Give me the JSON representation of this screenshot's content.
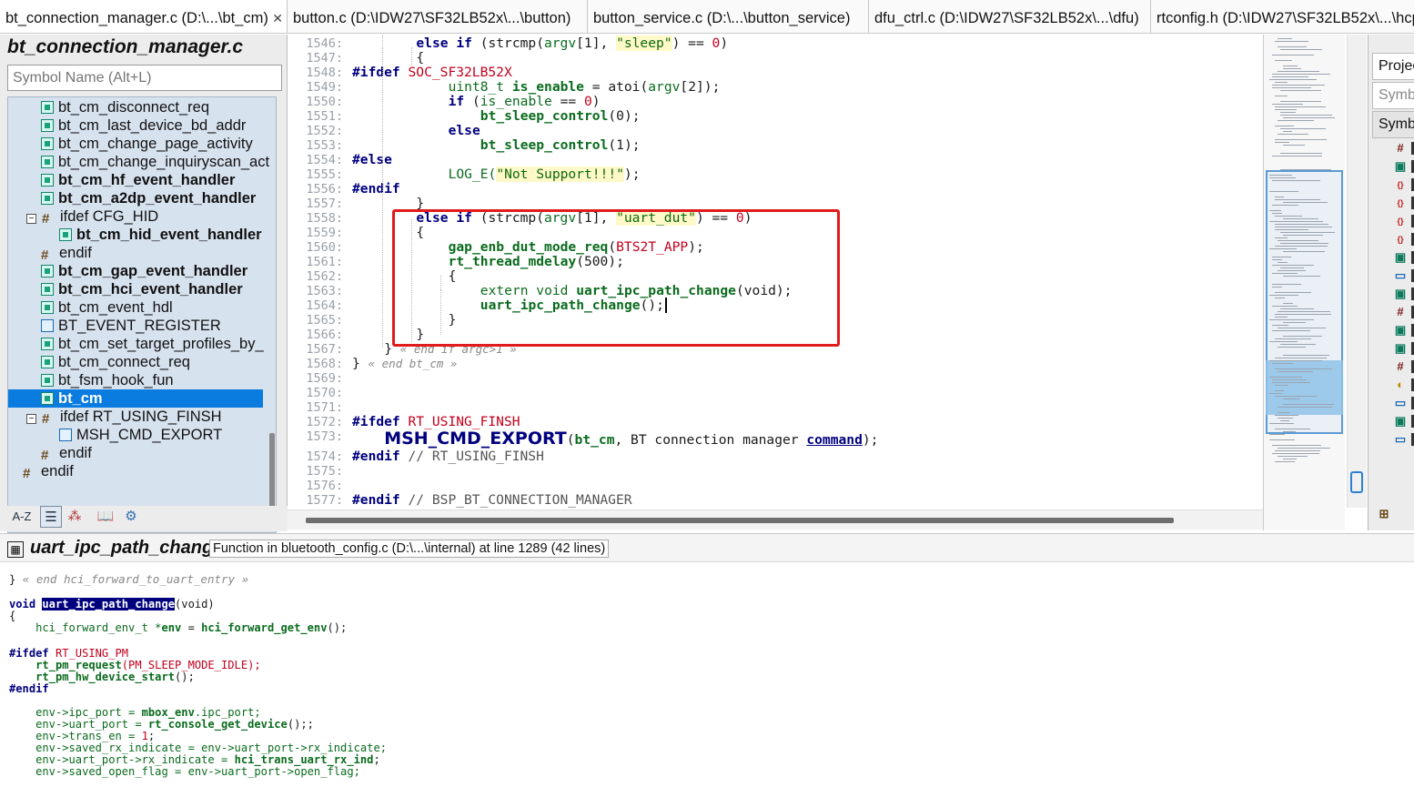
{
  "tabs": [
    {
      "label": "bt_connection_manager.c (D:\\...\\bt_cm)",
      "close": "✕"
    },
    {
      "label": "button.c (D:\\IDW27\\SF32LB52x\\...\\button)"
    },
    {
      "label": "button_service.c (D:\\...\\button_service)"
    },
    {
      "label": "dfu_ctrl.c (D:\\IDW27\\SF32LB52x\\...\\dfu)"
    },
    {
      "label": "rtconfig.h (D:\\IDW27\\SF32LB52x\\...\\hcp"
    }
  ],
  "left_panel": {
    "file_title": "bt_connection_manager.c",
    "search_placeholder": "Symbol Name (Alt+L)",
    "tree": [
      {
        "label": "bt_cm_disconnect_req",
        "bold": false
      },
      {
        "label": "bt_cm_last_device_bd_addr",
        "bold": false
      },
      {
        "label": "bt_cm_change_page_activity",
        "bold": false
      },
      {
        "label": "bt_cm_change_inquiryscan_act",
        "bold": false
      },
      {
        "label": "bt_cm_hf_event_handler",
        "bold": true
      },
      {
        "label": "bt_cm_a2dp_event_handler",
        "bold": true
      },
      {
        "label": "ifdef CFG_HID",
        "bold": false
      },
      {
        "label": "bt_cm_hid_event_handler",
        "bold": true
      },
      {
        "label": "endif",
        "bold": false
      },
      {
        "label": "bt_cm_gap_event_handler",
        "bold": true
      },
      {
        "label": "bt_cm_hci_event_handler",
        "bold": true
      },
      {
        "label": "bt_cm_event_hdl",
        "bold": false
      },
      {
        "label": "BT_EVENT_REGISTER",
        "bold": false
      },
      {
        "label": "bt_cm_set_target_profiles_by_",
        "bold": false
      },
      {
        "label": "bt_cm_connect_req",
        "bold": false
      },
      {
        "label": "bt_fsm_hook_fun",
        "bold": false
      },
      {
        "label": "bt_cm",
        "bold": true
      },
      {
        "label": "ifdef RT_USING_FINSH",
        "bold": false
      },
      {
        "label": "MSH_CMD_EXPORT",
        "bold": false
      },
      {
        "label": "endif",
        "bold": false
      },
      {
        "label": "endif",
        "bold": false
      }
    ],
    "toolbar": {
      "az": "A-Z"
    }
  },
  "editor": {
    "line_numbers": [
      "1546:",
      "1547:",
      "1548:",
      "1549:",
      "1550:",
      "1551:",
      "1552:",
      "1553:",
      "1554:",
      "1555:",
      "1556:",
      "1557:",
      "1558:",
      "1559:",
      "1560:",
      "1561:",
      "1562:",
      "1563:",
      "1564:",
      "1565:",
      "1566:",
      "1567:",
      "1568:",
      "1569:",
      "1570:",
      "1571:",
      "1572:",
      "1573:",
      "1574:",
      "1575:",
      "1576:",
      "1577:"
    ],
    "tokens": {
      "else_if": "else if",
      "strcmp_open": " (strcmp(",
      "argv": "argv",
      "idx1": "[1], ",
      "str_sleep": "\"sleep\"",
      "eq0": ") == ",
      "zero": "0",
      "close_paren": ")",
      "brace_open": "{",
      "brace_close": "}",
      "ifdef": "#ifdef",
      "soc_macro": "SOC_SF32LB52X",
      "uint8_t": "uint8_t ",
      "is_enable": "is_enable",
      "atoi_open": " = atoi(",
      "argv2": "[2]);",
      "if_kw": "if",
      "is_enable_cond_pre": " (",
      "is_enable_cond_post": " == ",
      "bt_sleep_control": "bt_sleep_control",
      "arg0": "(0);",
      "arg1": "(1);",
      "else_kw": "else",
      "pp_else": "#else",
      "log_e": "LOG_E(",
      "not_support": "\"Not Support!!!\"",
      "semi_close": ");",
      "endif": "#endif",
      "str_uart_dut": "\"uart_dut\"",
      "gap_call": "gap_enb_dut_mode_req",
      "bts2t_app": "BTS2T_APP",
      "rt_thread_mdelay": "rt_thread_mdelay",
      "arg500": "(500);",
      "extern_void": "extern void ",
      "uart_ipc_path_change": "uart_ipc_path_change",
      "void_args": "(void);",
      "call_args": "();",
      "end_if_argc": "« end if argc>1 »",
      "end_bt_cm": "« end bt_cm »",
      "rt_using_finsh": "RT_USING_FINSH",
      "msh_cmd_export": "MSH_CMD_EXPORT",
      "msh_args_pre": "(",
      "bt_cm": "bt_cm",
      "msh_args_mid": ", BT connection manager ",
      "command": "command",
      "endif_finsh_cmt": "// RT_USING_FINSH",
      "endif_bsp_cmt": "// BSP_BT_CONNECTION_MANAGER"
    }
  },
  "right_panel": {
    "tab1": "Projec",
    "search": "Symb",
    "tab2": "Symb"
  },
  "context": {
    "symbol_name": "uart_ipc_path_change",
    "info": "Function in bluetooth_config.c (D:\\...\\internal) at line 1289 (42 lines)",
    "code": {
      "l1_brace": "}",
      "l1_cmt": " « end hci_forward_to_uart_entry »",
      "void": "void ",
      "fname": "uart_ipc_path_change",
      "fargs": "(void)",
      "open": "{",
      "l4_type": "    hci_forward_env_t *",
      "l4_env": "env",
      "l4_eq": " = ",
      "l4_call": "hci_forward_get_env",
      "l4_end": "();",
      "ifdef": "#ifdef",
      "rt_using_pm": " RT_USING_PM",
      "pm_request": "    rt_pm_request",
      "pm_arg": "(PM_SLEEP_MODE_IDLE);",
      "pm_hw": "    rt_pm_hw_device_start",
      "pm_hw_end": "();",
      "endif": "#endif",
      "c1_a": "    env->ipc_port = ",
      "c1_b": "mbox_env",
      "c1_c": ".ipc_port;",
      "c2_a": "    env->uart_port = ",
      "c2_b": "rt_console_get_device",
      "c2_c": "();;",
      "c3_a": "    env->trans_en = ",
      "c3_b": "1",
      "c3_c": ";",
      "c4": "    env->saved_rx_indicate = env->uart_port->rx_indicate;",
      "c5_a": "    env->uart_port->rx_indicate = ",
      "c5_b": "hci_trans_uart_rx_ind",
      "c5_c": ";",
      "c6": "    env->saved_open_flag = env->uart_port->open_flag;"
    }
  }
}
